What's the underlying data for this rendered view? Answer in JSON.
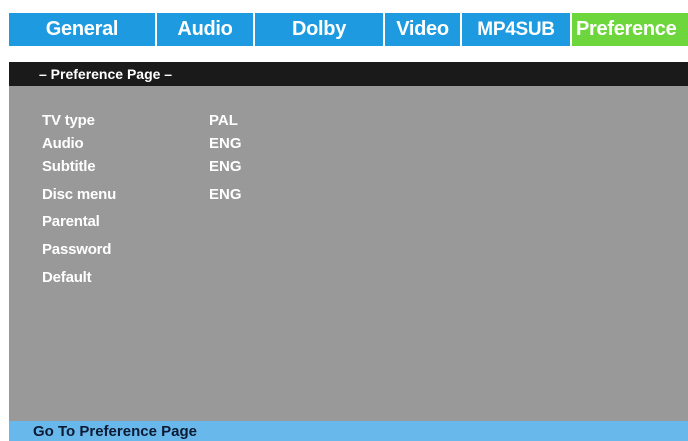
{
  "tabs": {
    "general": "General",
    "audio": "Audio",
    "dolby": "Dolby",
    "video": "Video",
    "mp4sub": "MP4SUB",
    "preference": "Preference"
  },
  "active_tab": "Preference",
  "page": {
    "title": "– Preference Page –"
  },
  "menu": {
    "items": [
      {
        "label": "TV type",
        "value": "PAL"
      },
      {
        "label": "Audio",
        "value": "ENG"
      },
      {
        "label": "Subtitle",
        "value": "ENG"
      },
      {
        "label": "Disc menu",
        "value": "ENG"
      },
      {
        "label": "Parental",
        "value": ""
      },
      {
        "label": "Password",
        "value": ""
      },
      {
        "label": "Default",
        "value": ""
      }
    ]
  },
  "status": {
    "text": "Go To Preference Page"
  },
  "colors": {
    "tab_bar": "#1e9ae0",
    "active_tab": "#6cd63c",
    "header": "#1a1a1a",
    "panel": "#999999",
    "status_bar": "#68b8ec"
  }
}
